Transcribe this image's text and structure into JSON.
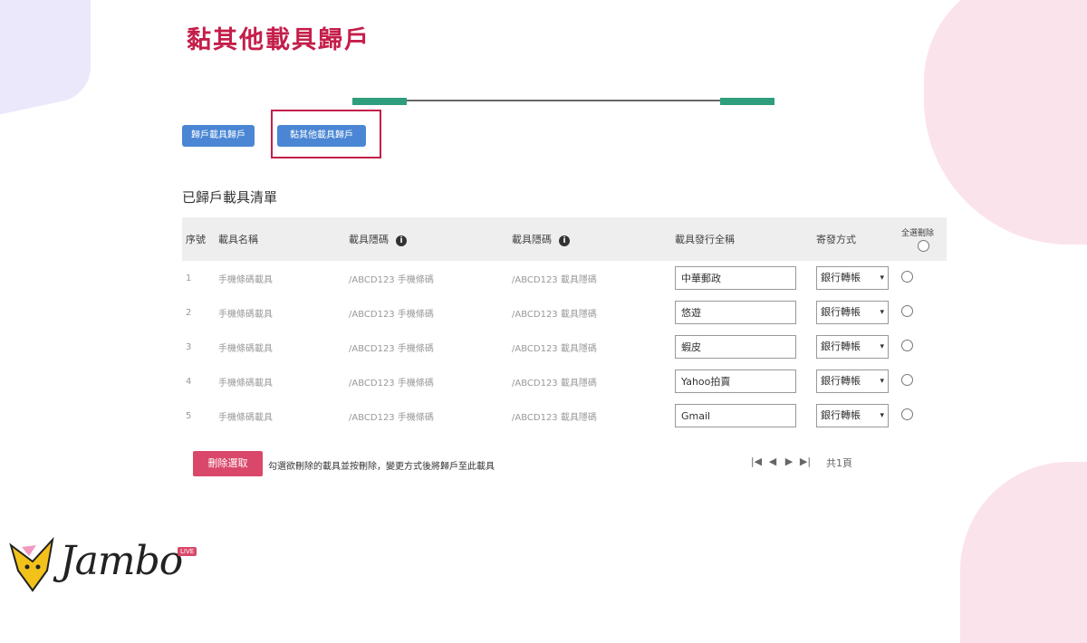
{
  "page": {
    "title": "黏其他載具歸戶"
  },
  "tabs": [
    {
      "label": "歸戶載具歸戶"
    },
    {
      "label": "黏其他載具歸戶"
    }
  ],
  "section_title": "已歸戶載具清單",
  "table": {
    "headers": {
      "index": "序號",
      "name": "載具名稱",
      "carrier_id": "載具隱碼",
      "carrier_code": "載具隱碼",
      "issuer": "載具發行全稱",
      "method": "寄發方式",
      "select_all": "全選刪除"
    },
    "rows": [
      {
        "index": "1",
        "name": "手機條碼載具",
        "carrier_id": "/ABCD123 手機條碼",
        "carrier_code": "/ABCD123 載具隱碼",
        "issuer": "中華郵政",
        "method": "銀行轉帳"
      },
      {
        "index": "2",
        "name": "手機條碼載具",
        "carrier_id": "/ABCD123 手機條碼",
        "carrier_code": "/ABCD123 載具隱碼",
        "issuer": "悠遊",
        "method": "銀行轉帳"
      },
      {
        "index": "3",
        "name": "手機條碼載具",
        "carrier_id": "/ABCD123 手機條碼",
        "carrier_code": "/ABCD123 載具隱碼",
        "issuer": "蝦皮",
        "method": "銀行轉帳"
      },
      {
        "index": "4",
        "name": "手機條碼載具",
        "carrier_id": "/ABCD123 手機條碼",
        "carrier_code": "/ABCD123 載具隱碼",
        "issuer": "Yahoo拍賣",
        "method": "銀行轉帳"
      },
      {
        "index": "5",
        "name": "手機條碼載具",
        "carrier_id": "/ABCD123 手機條碼",
        "carrier_code": "/ABCD123 載具隱碼",
        "issuer": "Gmail",
        "method": "銀行轉帳"
      }
    ]
  },
  "actions": {
    "delete_label": "刪除選取",
    "note": "勾選欲刪除的載具並按刪除，變更方式後將歸戶至此載具"
  },
  "pager": {
    "first": "|◀",
    "prev": "◀",
    "next": "▶",
    "last": "▶|",
    "count": "共1頁"
  },
  "logo": {
    "text": "Jambo",
    "badge": "LIVE"
  },
  "colors": {
    "title": "#c41e4a",
    "tab": "#4a86d4",
    "progress": "#2f9e7c",
    "delete": "#d9486a"
  }
}
